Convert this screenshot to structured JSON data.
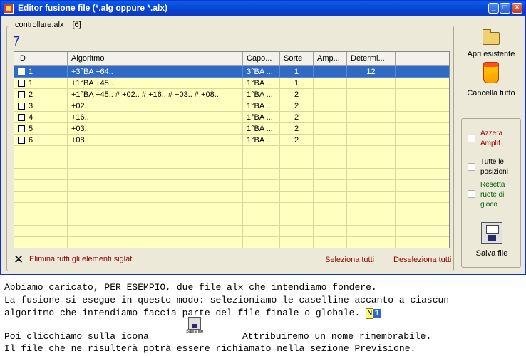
{
  "window": {
    "title": "Editor fusione file (*.alg oppure *.alx)"
  },
  "group": {
    "filename": "controllare.alx",
    "bracket": "[6]",
    "count": "7"
  },
  "grid": {
    "columns": [
      "ID",
      "Algoritmo",
      "Capo...",
      "Sorte",
      "Amp...",
      "Determi..."
    ],
    "rows": [
      {
        "id": "1",
        "algoritmo": "+3°BA +64..",
        "capo": "3°BA ...",
        "sorte": "1",
        "amp": "",
        "determi": "12",
        "selected": true
      },
      {
        "id": "1",
        "algoritmo": "+1°BA +45..",
        "capo": "1°BA ...",
        "sorte": "1",
        "amp": "",
        "determi": "",
        "selected": false
      },
      {
        "id": "2",
        "algoritmo": "+1°BA +45.. # +02.. # +16.. # +03.. # +08..",
        "capo": "1°BA ...",
        "sorte": "2",
        "amp": "",
        "determi": "",
        "selected": false
      },
      {
        "id": "3",
        "algoritmo": "+02..",
        "capo": "1°BA ...",
        "sorte": "2",
        "amp": "",
        "determi": "",
        "selected": false
      },
      {
        "id": "4",
        "algoritmo": "+16..",
        "capo": "1°BA ...",
        "sorte": "2",
        "amp": "",
        "determi": "",
        "selected": false
      },
      {
        "id": "5",
        "algoritmo": "+03..",
        "capo": "1°BA ...",
        "sorte": "2",
        "amp": "",
        "determi": "",
        "selected": false
      },
      {
        "id": "6",
        "algoritmo": "+08..",
        "capo": "1°BA ...",
        "sorte": "2",
        "amp": "",
        "determi": "",
        "selected": false
      }
    ]
  },
  "actions": {
    "elimina": "Elimina tutti gli elementi siglati",
    "seleziona": "Seleziona tutti",
    "deseleziona": "Deseleziona tutti"
  },
  "side": {
    "apri": "Apri esistente",
    "cancella": "Cancella tutto",
    "azzera": "Azzera Amplif.",
    "tutte": "Tutte le posizioni",
    "resetta": "Resetta ruote di gioco",
    "salva": "Salva file"
  },
  "text": {
    "line1": "Abbiamo caricato, PER ESEMPIO, due file alx che intendiamo fondere.",
    "line2": "La fusione si esegue in questo modo: selezioniamo le caselline accanto a ciascun",
    "line3": "algoritmo che intendiamo faccia parte del file finale o globale.",
    "badge1": "N",
    "badge2": "1",
    "line4a": "Poi clicchiamo sulla icona",
    "line4b": "Attribuiremo un nome rimembrabile.",
    "mini_save_label": "Salva file",
    "line5": "Il file che ne risulterà potrà essere richiamato nella sezione Previsione."
  },
  "colors": {
    "title_bar": "#0a4fe0",
    "grid_bg": "#ffffc0",
    "selected_row": "#316ac5",
    "link": "#990000"
  }
}
